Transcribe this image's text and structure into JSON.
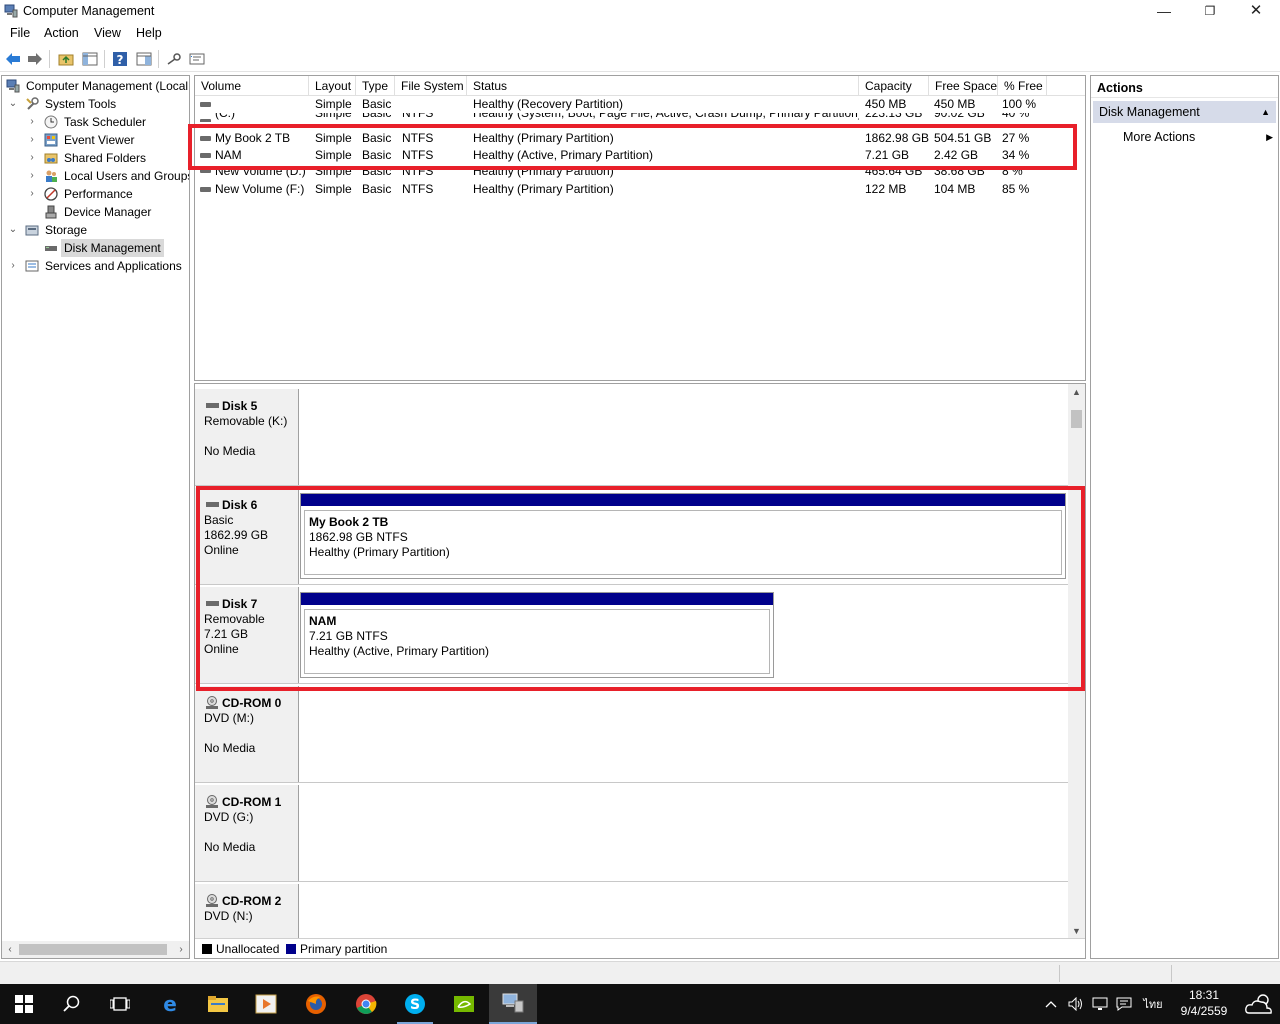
{
  "window": {
    "title": "Computer Management"
  },
  "menu": [
    "File",
    "Action",
    "View",
    "Help"
  ],
  "window_controls": {
    "minimize": "—",
    "maximize": "❐",
    "close": "✕"
  },
  "tree": {
    "root": "Computer Management (Local",
    "system_tools": "System Tools",
    "task_scheduler": "Task Scheduler",
    "event_viewer": "Event Viewer",
    "shared_folders": "Shared Folders",
    "local_users": "Local Users and Groups",
    "performance": "Performance",
    "device_manager": "Device Manager",
    "storage": "Storage",
    "disk_management": "Disk Management",
    "services": "Services and Applications"
  },
  "volumes": {
    "columns": [
      "Volume",
      "Layout",
      "Type",
      "File System",
      "Status",
      "Capacity",
      "Free Space",
      "% Free"
    ],
    "rows": [
      [
        "",
        "Simple",
        "Basic",
        "",
        "Healthy (Recovery Partition)",
        "450 MB",
        "450 MB",
        "100 %"
      ],
      [
        "(C:)",
        "Simple",
        "Basic",
        "NTFS",
        "Healthy (System, Boot, Page File, Active, Crash Dump, Primary Partition)",
        "223.13 GB",
        "90.02 GB",
        "40 %"
      ],
      [
        "My Book 2 TB",
        "Simple",
        "Basic",
        "NTFS",
        "Healthy (Primary Partition)",
        "1862.98 GB",
        "504.51 GB",
        "27 %"
      ],
      [
        "NAM",
        "Simple",
        "Basic",
        "NTFS",
        "Healthy (Active, Primary Partition)",
        "7.21 GB",
        "2.42 GB",
        "34 %"
      ],
      [
        "New Volume (D:)",
        "Simple",
        "Basic",
        "NTFS",
        "Healthy (Primary Partition)",
        "465.64 GB",
        "38.68 GB",
        "8 %"
      ],
      [
        "New Volume (F:)",
        "Simple",
        "Basic",
        "NTFS",
        "Healthy (Primary Partition)",
        "122 MB",
        "104 MB",
        "85 %"
      ]
    ]
  },
  "disks": [
    {
      "name": "Disk 5",
      "l1": "Removable (K:)",
      "l2": "",
      "l3": "No Media"
    },
    {
      "name": "Disk 6",
      "l1": "Basic",
      "l2": "1862.99 GB",
      "l3": "Online",
      "partition": {
        "name": "My Book 2 TB",
        "size": "1862.98 GB NTFS",
        "status": "Healthy (Primary Partition)"
      }
    },
    {
      "name": "Disk 7",
      "l1": "Removable",
      "l2": "7.21 GB",
      "l3": "Online",
      "partition": {
        "name": "NAM",
        "size": "7.21 GB NTFS",
        "status": "Healthy (Active, Primary Partition)"
      }
    },
    {
      "name": "CD-ROM 0",
      "l1": "DVD (M:)",
      "l2": "",
      "l3": "No Media"
    },
    {
      "name": "CD-ROM 1",
      "l1": "DVD (G:)",
      "l2": "",
      "l3": "No Media"
    },
    {
      "name": "CD-ROM 2",
      "l1": "DVD (N:)",
      "l2": "",
      "l3": ""
    }
  ],
  "legend": {
    "unallocated": "Unallocated",
    "primary": "Primary partition"
  },
  "actions": {
    "header": "Actions",
    "section": "Disk Management",
    "more": "More Actions"
  },
  "colors": {
    "primary_partition": "#00008b",
    "unallocated": "#000000",
    "highlight": "#e8202a"
  },
  "taskbar": {
    "icons": [
      "windows-start-icon",
      "search-icon",
      "task-view-icon",
      "edge-icon",
      "file-explorer-icon",
      "media-player-icon",
      "firefox-icon",
      "chrome-icon",
      "skype-icon",
      "nvidia-icon",
      "computer-management-icon"
    ],
    "language": "ไทย",
    "time": "18:31",
    "date": "9/4/2559"
  }
}
